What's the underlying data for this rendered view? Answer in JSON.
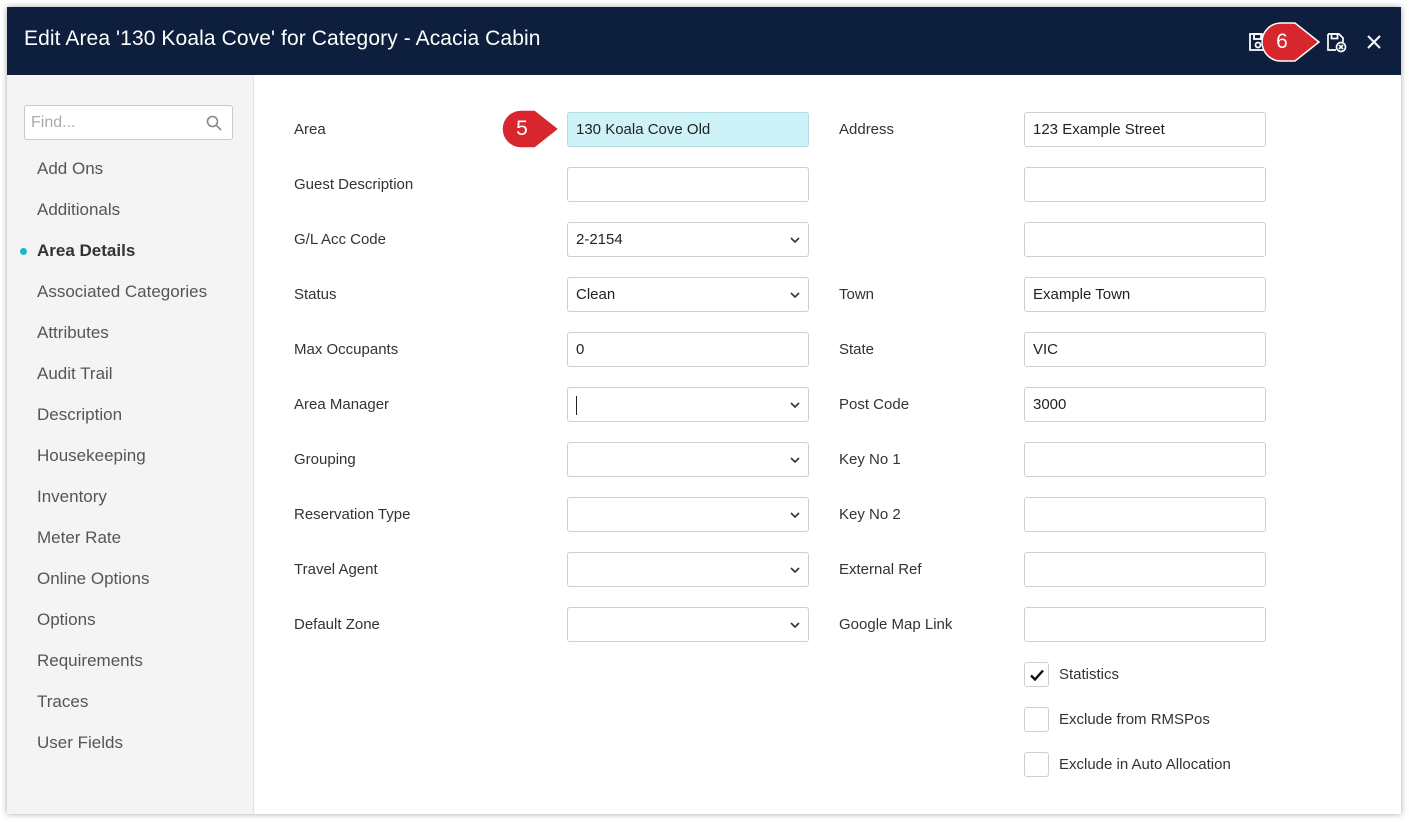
{
  "window": {
    "title": "Edit Area '130 Koala Cove' for Category - Acacia Cabin"
  },
  "toolbar": {
    "icons": [
      "save-icon",
      "save-and-close-icon",
      "close-icon"
    ]
  },
  "sidebar": {
    "search_placeholder": "Find...",
    "items": [
      {
        "label": "Add Ons"
      },
      {
        "label": "Additionals"
      },
      {
        "label": "Area Details",
        "active": true
      },
      {
        "label": "Associated Categories"
      },
      {
        "label": "Attributes"
      },
      {
        "label": "Audit Trail"
      },
      {
        "label": "Description"
      },
      {
        "label": "Housekeeping"
      },
      {
        "label": "Inventory"
      },
      {
        "label": "Meter Rate"
      },
      {
        "label": "Online Options"
      },
      {
        "label": "Options"
      },
      {
        "label": "Requirements"
      },
      {
        "label": "Traces"
      },
      {
        "label": "User Fields"
      }
    ]
  },
  "form": {
    "left": [
      {
        "label": "Area",
        "value": "130 Koala Cove Old",
        "type": "text"
      },
      {
        "label": "Guest Description",
        "value": "",
        "type": "text"
      },
      {
        "label": "G/L Acc Code",
        "value": "2-2154",
        "type": "select"
      },
      {
        "label": "Status",
        "value": "Clean",
        "type": "select"
      },
      {
        "label": "Max Occupants",
        "value": "0",
        "type": "text"
      },
      {
        "label": "Area Manager",
        "value": "",
        "type": "select"
      },
      {
        "label": "Grouping",
        "value": "",
        "type": "select"
      },
      {
        "label": "Reservation Type",
        "value": "",
        "type": "select"
      },
      {
        "label": "Travel Agent",
        "value": "",
        "type": "select"
      },
      {
        "label": "Default Zone",
        "value": "",
        "type": "select"
      }
    ],
    "right": [
      {
        "label": "Address",
        "value": "123 Example Street"
      },
      {
        "label": "",
        "value": ""
      },
      {
        "label": "",
        "value": ""
      },
      {
        "label": "Town",
        "value": "Example Town"
      },
      {
        "label": "State",
        "value": "VIC"
      },
      {
        "label": "Post Code",
        "value": "3000"
      },
      {
        "label": "Key No 1",
        "value": ""
      },
      {
        "label": "Key No 2",
        "value": ""
      },
      {
        "label": "External Ref",
        "value": ""
      },
      {
        "label": "Google Map Link",
        "value": ""
      }
    ],
    "checkboxes": [
      {
        "label": "Statistics",
        "checked": true
      },
      {
        "label": "Exclude from RMSPos",
        "checked": false
      },
      {
        "label": "Exclude in Auto Allocation",
        "checked": false
      }
    ]
  },
  "callouts": {
    "step5": "5",
    "step6": "6",
    "color": "#d7262e"
  },
  "colors": {
    "titlebar": "#0d1f3c",
    "active_dot": "#1fb6c7",
    "highlight_field": "#cdf3f8"
  }
}
